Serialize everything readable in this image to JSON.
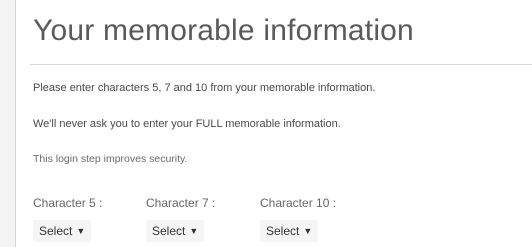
{
  "page": {
    "title": "Your memorable information",
    "instruction": "Please enter characters 5, 7 and 10 from your memorable information.",
    "never_ask": "We'll never ask you to enter your FULL memorable information.",
    "security_note": "This login step improves security."
  },
  "characters": [
    {
      "label": "Character 5 :",
      "select_value": "Select"
    },
    {
      "label": "Character 7 :",
      "select_value": "Select"
    },
    {
      "label": "Character 10 :",
      "select_value": "Select"
    }
  ],
  "icons": {
    "dropdown": "caret-down-icon"
  }
}
